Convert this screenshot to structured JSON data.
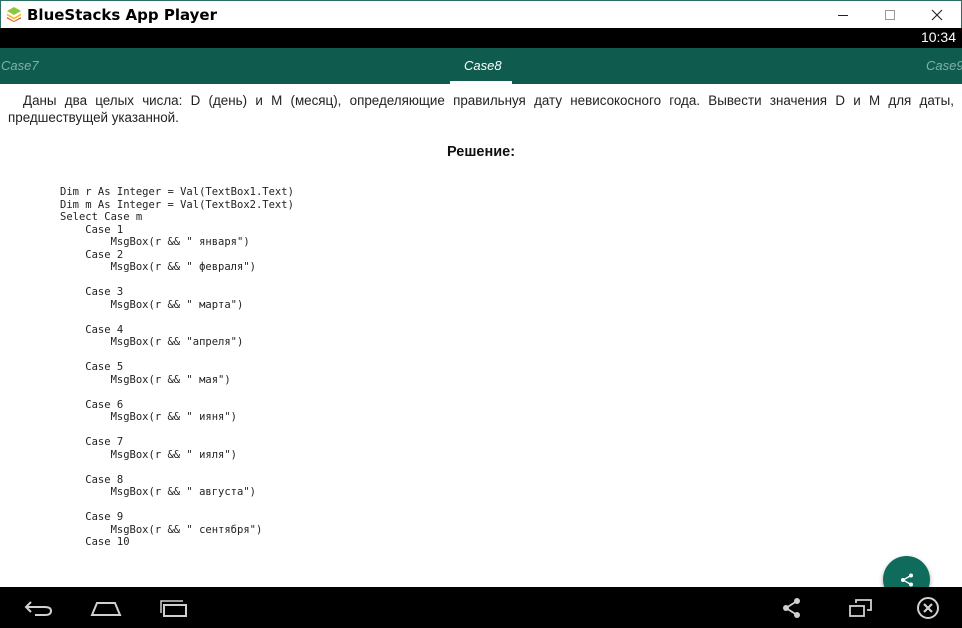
{
  "window": {
    "title": "BlueStacks App Player"
  },
  "status_bar": {
    "time": "10:34"
  },
  "tabs": {
    "previous": "Case7",
    "current": "Case8",
    "next": "Case9"
  },
  "content": {
    "task": "Даны два целых числа: D (день) и M (месяц), определяющие правильнуя дату невисокосного года. Вывести значения D и M для даты, предшествущей указанной.",
    "solution_heading": "Решение:",
    "code_lines": [
      "Dim r As Integer = Val(TextBox1.Text)",
      "Dim m As Integer = Val(TextBox2.Text)",
      "Select Case m",
      "    Case 1",
      "        MsgBox(r && \" января\")",
      "    Case 2",
      "        MsgBox(r && \" февраля\")",
      "    Case 3",
      "        MsgBox(r && \" марта\")",
      "    Case 4",
      "        MsgBox(r && \"апреля\")",
      "    Case 5",
      "        MsgBox(r && \" мая\")",
      "    Case 6",
      "        MsgBox(r && \" ияня\")",
      "    Case 7",
      "        MsgBox(r && \" ияля\")",
      "    Case 8",
      "        MsgBox(r && \" августа\")",
      "    Case 9",
      "        MsgBox(r && \" сентября\")",
      "    Case 10"
    ]
  },
  "colors": {
    "accent": "#0f5c4f",
    "fab": "#0f6b5b",
    "inactive_tab_text": "#7fb1a7"
  },
  "icons": {
    "app": "bluestacks-logo-icon",
    "fab": "share-icon",
    "nav": [
      "back-icon",
      "home-icon",
      "recent-apps-icon",
      "share-icon",
      "multi-window-icon",
      "close-icon"
    ]
  }
}
